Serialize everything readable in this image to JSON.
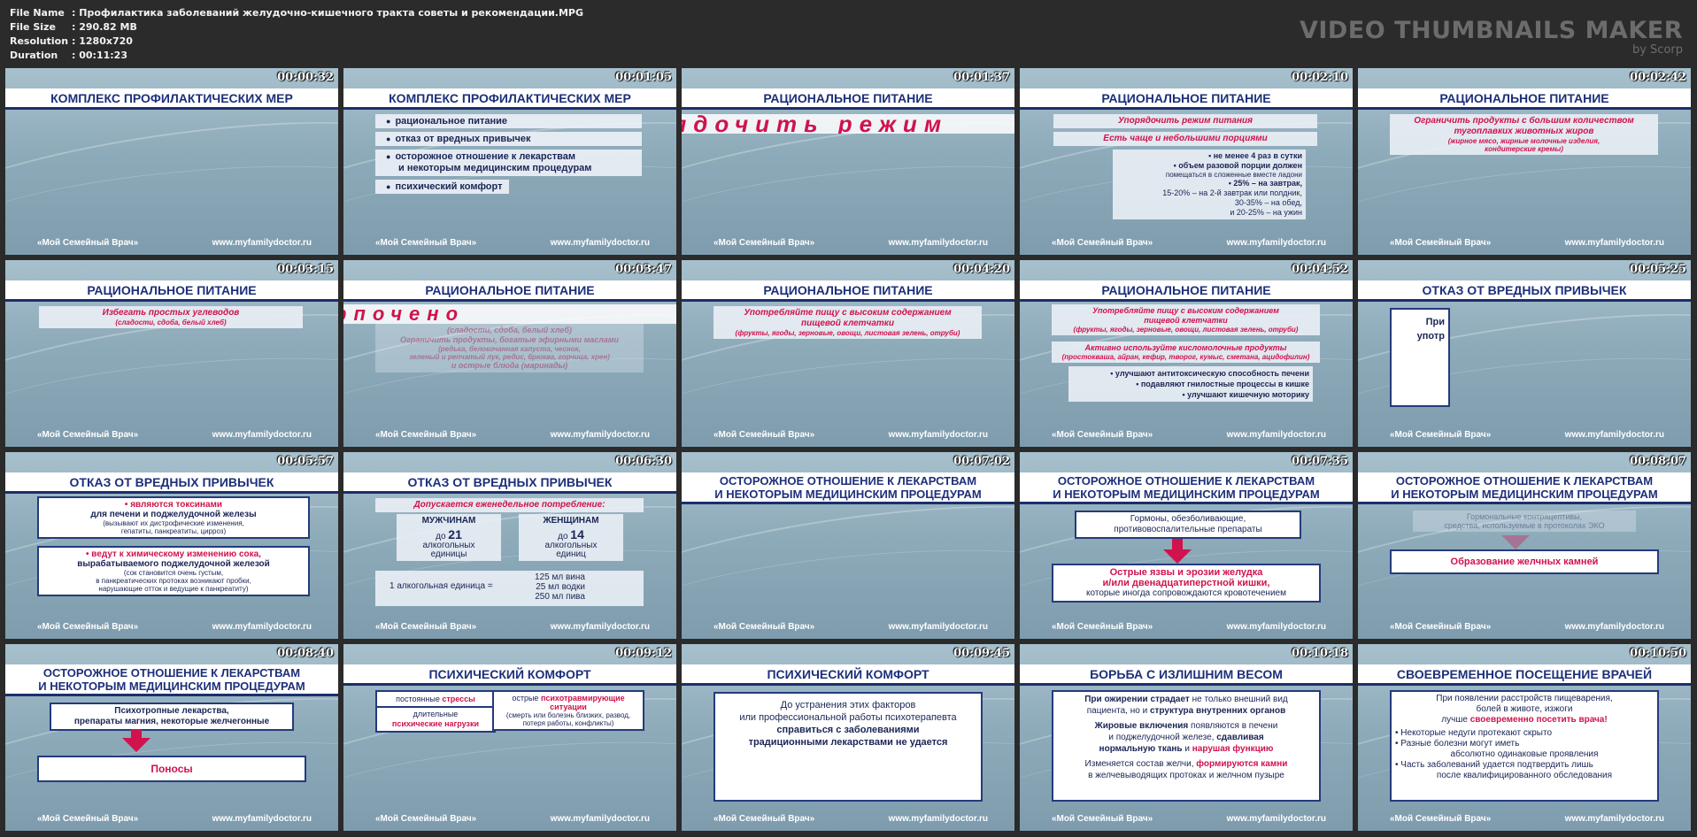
{
  "info": {
    "file_name_label": "File Name",
    "file_name": "Профилактика заболеваний желудочно-кишечного тракта советы и рекомендации.MPG",
    "file_size_label": "File Size",
    "file_size": "290.82 MB",
    "resolution_label": "Resolution",
    "resolution": "1280x720",
    "duration_label": "Duration",
    "duration": "00:11:23",
    "separator": ":"
  },
  "brand": {
    "title": "VIDEO THUMBNAILS MAKER",
    "subtitle": "by Scorp"
  },
  "footer": {
    "left": "«Мой Семейный Врач»",
    "right": "www.myfamilydoctor.ru"
  },
  "thumbs": [
    {
      "time": "00:00:32",
      "title": "КОМПЛЕКС ПРОФИЛАКТИЧЕСКИХ МЕР"
    },
    {
      "time": "00:01:05",
      "title": "КОМПЛЕКС ПРОФИЛАКТИЧЕСКИХ МЕР",
      "items": [
        "рациональное питание",
        "отказ от вредных привычек",
        "осторожное отношение к лекарствам",
        "и некоторым медицинским процедурам",
        "психический комфорт"
      ]
    },
    {
      "time": "00:01:37",
      "title": "РАЦИОНАЛЬНОЕ ПИТАНИЕ",
      "marquee": "ядочить режим"
    },
    {
      "time": "00:02:10",
      "title": "РАЦИОНАЛЬНОЕ ПИТАНИЕ",
      "l1": "Упорядочить режим питания",
      "l2": "Есть чаще и небольшими порциями",
      "b1": "• не менее 4 раз в сутки",
      "b2": "• объем разовой порции должен",
      "b3": "помещаться в сложенные вместе ладони",
      "b4": "• 25% – на завтрак,",
      "b5": "15-20% – на 2-й завтрак или полдник,",
      "b6": "30-35% – на обед,",
      "b7": "и 20-25% – на ужин"
    },
    {
      "time": "00:02:42",
      "title": "РАЦИОНАЛЬНОЕ ПИТАНИЕ",
      "l1": "Ограничить продукты с большим количеством",
      "l2": "тугоплавких животных жиров",
      "l3": "(жирное мясо, жирные молочные изделия,",
      "l4": "кондитерские кремы)"
    },
    {
      "time": "00:03:15",
      "title": "РАЦИОНАЛЬНОЕ ПИТАНИЕ",
      "l1": "Избегать простых углеводов",
      "l2": "(сладости, сдоба, белый хлеб)"
    },
    {
      "time": "00:03:47",
      "title": "РАЦИОНАЛЬНОЕ ПИТАНИЕ",
      "marquee": "рпочено",
      "g1": "(сладости, сдоба, белый хлеб)",
      "g2": "Ограничить продукты, богатые эфирными маслами",
      "g3": "(редька, белокочанная капуста, чеснок,",
      "g4": "зеленый и репчатый лук, редис, брюква, горчица, хрен)",
      "g5": "и острые блюда (маринады)"
    },
    {
      "time": "00:04:20",
      "title": "РАЦИОНАЛЬНОЕ ПИТАНИЕ",
      "l1": "Употребляйте пищу с высоким содержанием",
      "l2": "пищевой клетчатки",
      "l3": "(фрукты, ягоды, зерновые, овощи, листовая зелень, отруби)"
    },
    {
      "time": "00:04:52",
      "title": "РАЦИОНАЛЬНОЕ ПИТАНИЕ",
      "l1": "Употребляйте пищу с высоким содержанием",
      "l2": "пищевой клетчатки",
      "l3": "(фрукты, ягоды, зерновые, овощи, листовая зелень, отруби)",
      "l4": "Активно используйте кисломолочные продукты",
      "l5": "(простокваша, айран, кефир, творог, кумыс, сметана, ацидофилин)",
      "b1": "• улучшают антитоксическую способность печени",
      "b2": "• подавляют гнилостные процессы в кишке",
      "b3": "• улучшают кишечную моторику"
    },
    {
      "time": "00:05:25",
      "title": "ОТКАЗ ОТ ВРЕДНЫХ ПРИВЫЧЕК",
      "l1": "При",
      "l2": "употр"
    },
    {
      "time": "00:05:57",
      "title": "ОТКАЗ ОТ ВРЕДНЫХ ПРИВЫЧЕК",
      "a1": "• являются токсинами",
      "a2": "для печени и поджелудочной железы",
      "a3": "(вызывают их дистрофические изменения,",
      "a4": "гепатиты, панкреатиты, цирроз)",
      "c1": "• ведут к химическому изменению сока,",
      "c2": "вырабатываемого поджелудочной железой",
      "c3": "(сок становится очень густым,",
      "c4": "в панкреатических протоках возникают пробки,",
      "c5": "нарушающие отток и ведущие к панкреатиту)"
    },
    {
      "time": "00:06:30",
      "title": "ОТКАЗ ОТ ВРЕДНЫХ ПРИВЫЧЕК",
      "head": "Допускается еженедельное потребление:",
      "men": "МУЖЧИНАМ",
      "women": "ЖЕНЩИНАМ",
      "men_pre": "до",
      "men_num": "21",
      "women_pre": "до",
      "women_num": "14",
      "unit1": "алкогольных",
      "unit2": "единицы",
      "unit3": "алкогольных",
      "unit4": "единиц",
      "eq": "1 алкогольная единица =",
      "e1": "125 мл вина",
      "e2": "25 мл водки",
      "e3": "250 мл пива"
    },
    {
      "time": "00:07:02",
      "title1": "ОСТОРОЖНОЕ ОТНОШЕНИЕ К ЛЕКАРСТВАМ",
      "title2": "И НЕКОТОРЫМ МЕДИЦИНСКИМ ПРОЦЕДУРАМ"
    },
    {
      "time": "00:07:35",
      "title1": "ОСТОРОЖНОЕ ОТНОШЕНИЕ К ЛЕКАРСТВАМ",
      "title2": "И НЕКОТОРЫМ МЕДИЦИНСКИМ ПРОЦЕДУРАМ",
      "top1": "Гормоны, обезболивающие,",
      "top2": "противовоспалительные препараты",
      "bot1": "Острые язвы и эрозии желудка",
      "bot2": "и/или двенадцатиперстной кишки,",
      "bot3": "которые иногда сопровождаются кровотечением"
    },
    {
      "time": "00:08:07",
      "title1": "ОСТОРОЖНОЕ ОТНОШЕНИЕ К ЛЕКАРСТВАМ",
      "title2": "И НЕКОТОРЫМ МЕДИЦИНСКИМ ПРОЦЕДУРАМ",
      "top1": "Гормональные контрацептивы,",
      "top2": "средства, используемые в протоколах ЭКО",
      "bot1": "Образование желчных камней"
    },
    {
      "time": "00:08:40",
      "title1": "ОСТОРОЖНОЕ ОТНОШЕНИЕ К ЛЕКАРСТВАМ",
      "title2": "И НЕКОТОРЫМ МЕДИЦИНСКИМ ПРОЦЕДУРАМ",
      "top1": "Психотропные лекарства,",
      "top2": "препараты магния, некоторые желчегонные",
      "bot1": "Поносы"
    },
    {
      "time": "00:09:12",
      "title": "ПСИХИЧЕСКИЙ КОМФОРТ",
      "p1a": "постоянные",
      "p1b": "стрессы",
      "p2a": "длительные",
      "p2b": "психические нагрузки",
      "p3a": "острые",
      "p3b": "психотравмирующие",
      "p3c": "ситуации",
      "p3d": "(смерть или болезнь близких, развод,",
      "p3e": "потеря работы, конфликты)"
    },
    {
      "time": "00:09:45",
      "title": "ПСИХИЧЕСКИЙ КОМФОРТ",
      "l1": "До устранения этих факторов",
      "l2": "или профессиональной работы психотерапевта",
      "l3": "справиться с заболеваниями",
      "l4": "традиционными лекарствами не удается"
    },
    {
      "time": "00:10:18",
      "title": "БОРЬБА С ИЗЛИШНИМ ВЕСОМ",
      "l1a": "При ожирении страдает",
      "l1b": "не только внешний вид",
      "l2a": "пациента, но и",
      "l2b": "структура внутренних органов",
      "l3a": "Жировые включения",
      "l3b": "появляются в печени",
      "l4a": "и поджелудочной железе,",
      "l4b": "сдавливая",
      "l5a": "нормальную ткань",
      "l5b": "и",
      "l5c": "нарушая функцию",
      "l6a": "Изменяется состав желчи,",
      "l6b": "формируются камни",
      "l7": "в желчевыводящих протоках и желчном пузыре"
    },
    {
      "time": "00:10:50",
      "title": "СВОЕВРЕМЕННОЕ ПОСЕЩЕНИЕ ВРАЧЕЙ",
      "l1": "При появлении расстройств пищеварения,",
      "l2": "болей в животе, изжоги",
      "l3a": "лучше",
      "l3b": "своевременно посетить врача!",
      "b1": "• Некоторые недуги протекают скрыто",
      "b2": "• Разные болезни могут иметь",
      "b3": "абсолютно одинаковые проявления",
      "b4": "• Часть заболеваний удается подтвердить лишь",
      "b5": "после квалифицированного обследования"
    }
  ]
}
